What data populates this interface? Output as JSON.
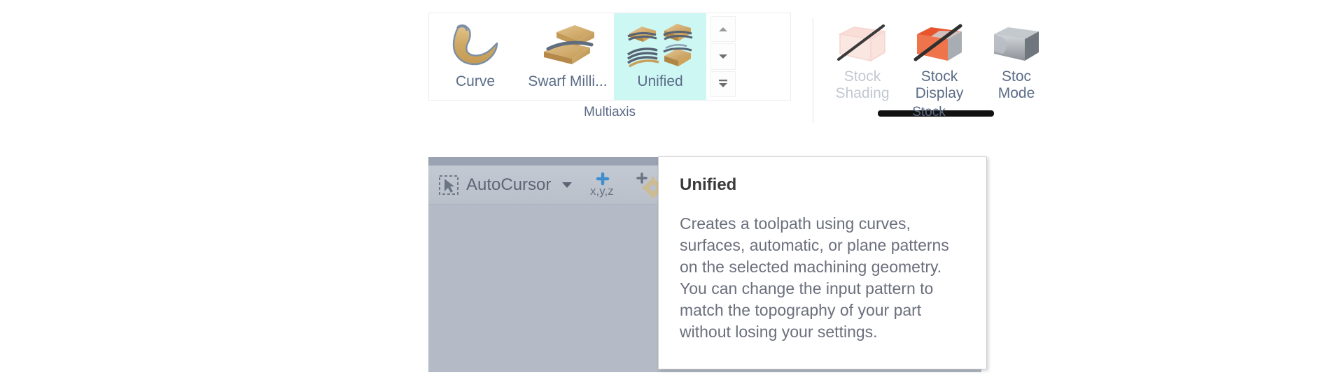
{
  "ribbon": {
    "groups": [
      {
        "name": "Multiaxis",
        "label": "Multiaxis",
        "buttons": [
          {
            "label": "Curve",
            "icon": "curve-surface-icon",
            "state": "normal"
          },
          {
            "label": "Swarf Milli...",
            "icon": "swarf-milling-icon",
            "state": "normal"
          },
          {
            "label": "Unified",
            "icon": "unified-toolpath-icon",
            "state": "selected"
          }
        ],
        "spinner": {
          "up": "scroll-up-arrow",
          "down": "scroll-down-arrow",
          "more": "gallery-expand-arrow"
        }
      },
      {
        "name": "Stock",
        "label": "Stock",
        "buttons": [
          {
            "label": "Stock\nShading",
            "label_line1": "Stock",
            "label_line2": "Shading",
            "icon": "stock-shading-icon",
            "state": "disabled"
          },
          {
            "label": "Stock\nDisplay",
            "label_line1": "Stock",
            "label_line2": "Display",
            "icon": "stock-display-icon",
            "state": "normal"
          },
          {
            "label": "Stock\nModel",
            "label_line1": "Stoc",
            "label_line2": "Mode",
            "icon": "stock-model-icon",
            "state": "normal"
          }
        ]
      }
    ]
  },
  "toolbar": {
    "autocursor_label": "AutoCursor",
    "autocursor_icon": "autocursor-arrow-icon",
    "dropdown_icon": "chevron-down-icon",
    "xyz_label": "x,y,z",
    "xyz_icon": "xyz-point-icon",
    "settings_icon": "gear-icon"
  },
  "tooltip": {
    "title": "Unified",
    "body": "Creates a toolpath using curves, surfaces, automatic, or plane patterns on the selected machining geometry. You can change the input pattern to match the topography of your part without losing your settings."
  },
  "colors": {
    "selected_button_bg": "#ccf7f3",
    "selected_underline": "#111111",
    "label_text": "#5a6b86",
    "disabled_text": "#c2c8d0",
    "canvas_bg": "#b4bbc6",
    "toolbar_bg": "#c3c9d2",
    "tooltip_bg": "#ffffff",
    "tooltip_body_text": "#6b6f7c",
    "stock_orange": "#e8552d"
  }
}
